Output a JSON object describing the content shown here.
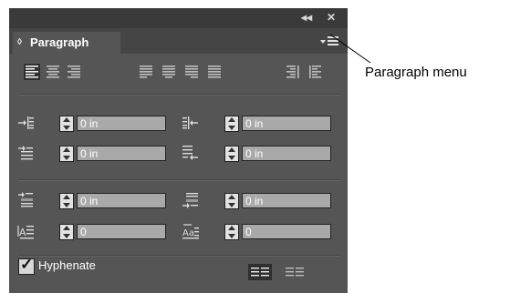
{
  "panel": {
    "tab_label": "Paragraph",
    "title_icons": [
      "collapse-icon",
      "close-icon"
    ],
    "alignment_buttons": [
      "align-left",
      "align-center",
      "align-right",
      "justify-last-left",
      "justify-last-center",
      "justify-last-right",
      "justify-all",
      "align-toward-spine",
      "align-away-from-spine"
    ],
    "selected_alignment": "align-left",
    "fields": {
      "left_indent": "0 in",
      "right_indent": "0 in",
      "first_line_indent": "0 in",
      "last_line_right_indent": "0 in",
      "space_before": "0 in",
      "space_after": "0 in",
      "drop_cap_lines": "0",
      "drop_cap_characters": "0"
    },
    "hyphenate_label": "Hyphenate",
    "hyphenate_checked": true
  },
  "callout": {
    "label": "Paragraph menu"
  }
}
